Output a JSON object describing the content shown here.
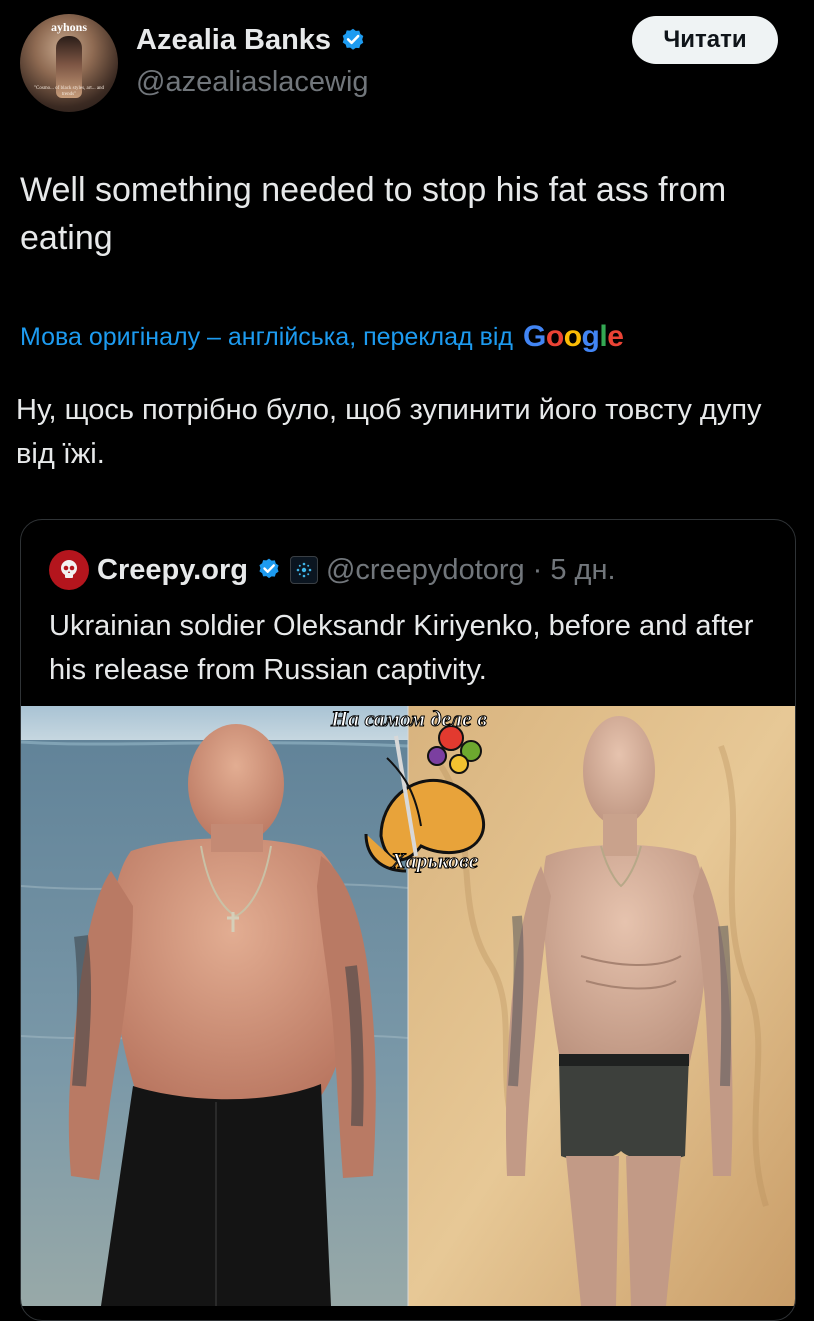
{
  "author": {
    "name": "Azealia Banks",
    "handle": "@azealiaslacewig",
    "avatar_title": "ayhons",
    "avatar_blurb": "\"Cosmo... of black styles, art... and trends\""
  },
  "follow_button": "Читати",
  "tweet_text": "Well something needed to stop his fat ass from eating",
  "translation_note": "Мова оригіналу – англійська, переклад від",
  "google_letters": [
    {
      "ch": "G",
      "color": "#4285F4"
    },
    {
      "ch": "o",
      "color": "#EA4335"
    },
    {
      "ch": "o",
      "color": "#FBBC05"
    },
    {
      "ch": "g",
      "color": "#4285F4"
    },
    {
      "ch": "l",
      "color": "#34A853"
    },
    {
      "ch": "e",
      "color": "#EA4335"
    }
  ],
  "translated_text": "Ну, щось потрібно було, щоб зупинити його товсту дупу від їжі.",
  "quote": {
    "name": "Creepy.org",
    "handle": "@creepydotorg",
    "separator": "·",
    "time": "5 дн.",
    "text": "Ukrainian soldier Oleksandr Kiriyenko, before and after his release from Russian captivity.",
    "watermark_top": "На самом деле в",
    "watermark_bottom": "Харькове"
  },
  "colors": {
    "accent": "#1d9bf0",
    "muted": "#71767b",
    "text": "#e7e9ea",
    "background": "#000000"
  },
  "icons": [
    "verified-badge-icon",
    "skull-logo-icon",
    "affiliate-badge-icon",
    "cornucopia-watermark"
  ]
}
